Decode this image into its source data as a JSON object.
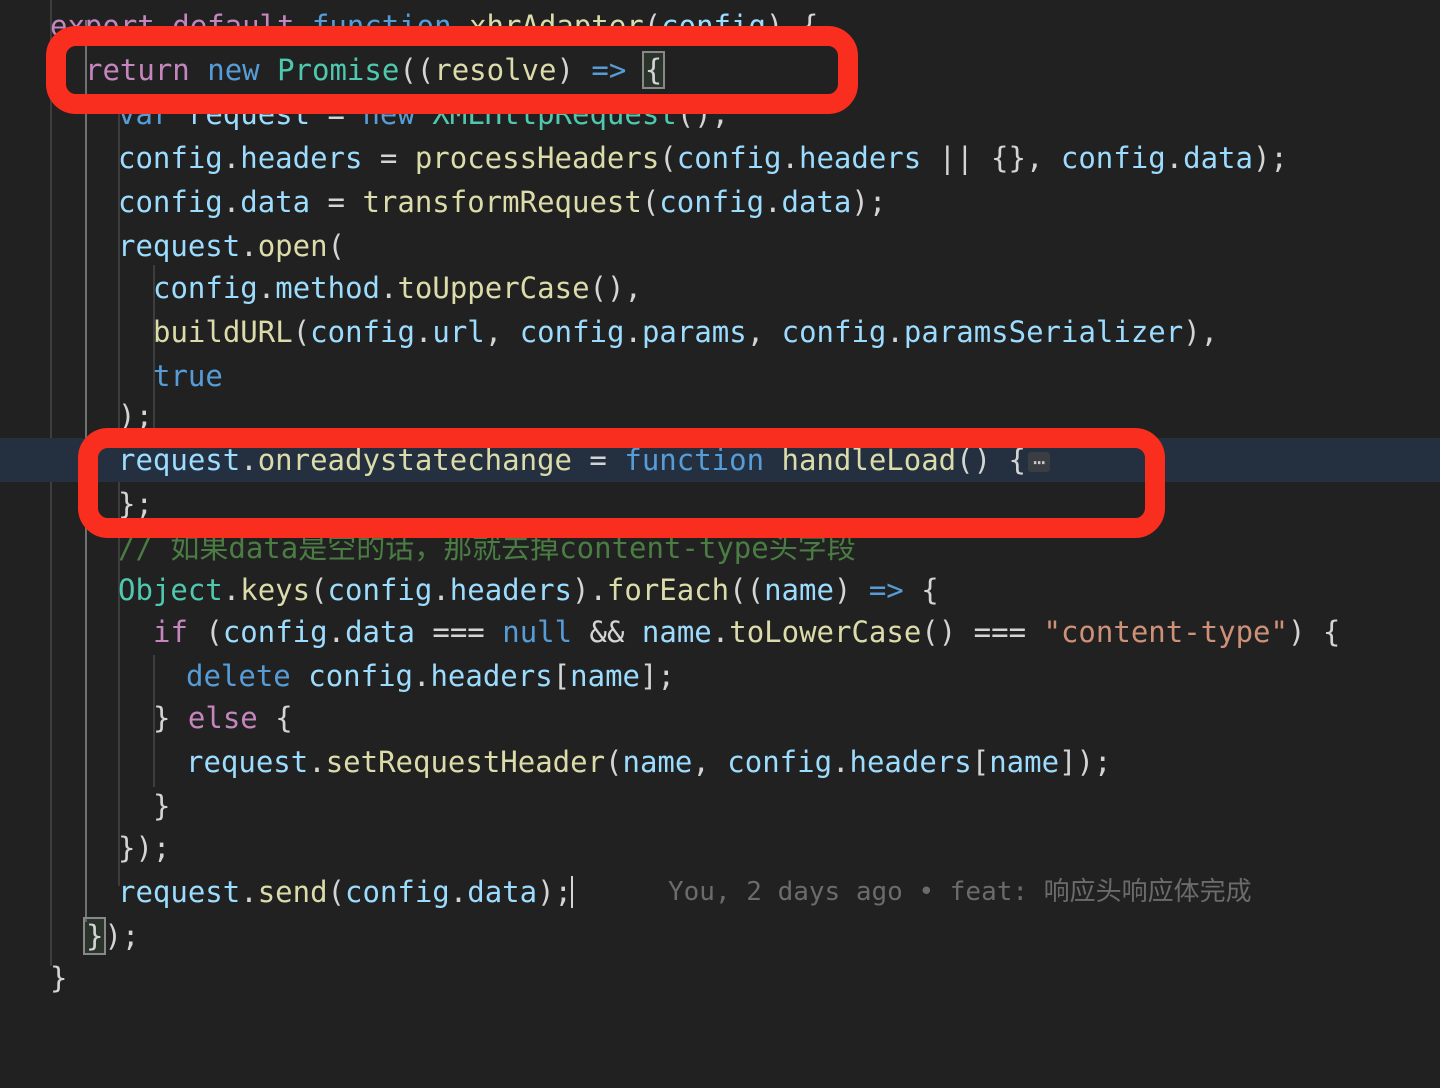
{
  "editor": {
    "theme_background": "#212121",
    "active_line_background": "#243040",
    "annotation_color": "#f92e1e",
    "gutter": {
      "fold_icon": "chevron-right-icon",
      "fold_icon_line": 12
    },
    "lines": [
      {
        "n": 1,
        "indent": 0,
        "text": "export default function xhrAdapter(config) {",
        "tokens": [
          {
            "t": "export",
            "c": "k"
          },
          {
            "t": " ",
            "c": "pl"
          },
          {
            "t": "default",
            "c": "k"
          },
          {
            "t": " ",
            "c": "pl"
          },
          {
            "t": "function",
            "c": "kb"
          },
          {
            "t": " ",
            "c": "pl"
          },
          {
            "t": "xhrAdapter",
            "c": "fn"
          },
          {
            "t": "(",
            "c": "op"
          },
          {
            "t": "config",
            "c": "var"
          },
          {
            "t": ") {",
            "c": "op"
          }
        ]
      },
      {
        "n": 2,
        "indent": 1,
        "text": "return new Promise((resolve) => {",
        "tokens": [
          {
            "t": "return",
            "c": "k"
          },
          {
            "t": " ",
            "c": "pl"
          },
          {
            "t": "new",
            "c": "kb"
          },
          {
            "t": " ",
            "c": "pl"
          },
          {
            "t": "Promise",
            "c": "cls"
          },
          {
            "t": "((",
            "c": "op"
          },
          {
            "t": "resolve",
            "c": "fn"
          },
          {
            "t": ") ",
            "c": "op"
          },
          {
            "t": "=>",
            "c": "arw"
          },
          {
            "t": " ",
            "c": "pl"
          },
          {
            "t": "{",
            "c": "bracket-match"
          }
        ]
      },
      {
        "n": 3,
        "indent": 2,
        "text": "var request = new XMLHttpRequest();",
        "tokens": [
          {
            "t": "var",
            "c": "kb"
          },
          {
            "t": " ",
            "c": "pl"
          },
          {
            "t": "request",
            "c": "var"
          },
          {
            "t": " = ",
            "c": "op"
          },
          {
            "t": "new",
            "c": "kb"
          },
          {
            "t": " ",
            "c": "pl"
          },
          {
            "t": "XMLHttpRequest",
            "c": "cls"
          },
          {
            "t": "();",
            "c": "op"
          }
        ]
      },
      {
        "n": 4,
        "indent": 2,
        "text": "config.headers = processHeaders(config.headers || {}, config.data);",
        "tokens": [
          {
            "t": "config",
            "c": "var"
          },
          {
            "t": ".",
            "c": "op"
          },
          {
            "t": "headers",
            "c": "var"
          },
          {
            "t": " = ",
            "c": "op"
          },
          {
            "t": "processHeaders",
            "c": "fn"
          },
          {
            "t": "(",
            "c": "op"
          },
          {
            "t": "config",
            "c": "var"
          },
          {
            "t": ".",
            "c": "op"
          },
          {
            "t": "headers",
            "c": "var"
          },
          {
            "t": " || {}, ",
            "c": "op"
          },
          {
            "t": "config",
            "c": "var"
          },
          {
            "t": ".",
            "c": "op"
          },
          {
            "t": "data",
            "c": "var"
          },
          {
            "t": ");",
            "c": "op"
          }
        ]
      },
      {
        "n": 5,
        "indent": 2,
        "text": "config.data = transformRequest(config.data);",
        "tokens": [
          {
            "t": "config",
            "c": "var"
          },
          {
            "t": ".",
            "c": "op"
          },
          {
            "t": "data",
            "c": "var"
          },
          {
            "t": " = ",
            "c": "op"
          },
          {
            "t": "transformRequest",
            "c": "fn"
          },
          {
            "t": "(",
            "c": "op"
          },
          {
            "t": "config",
            "c": "var"
          },
          {
            "t": ".",
            "c": "op"
          },
          {
            "t": "data",
            "c": "var"
          },
          {
            "t": ");",
            "c": "op"
          }
        ]
      },
      {
        "n": 6,
        "indent": 2,
        "text": "request.open(",
        "tokens": [
          {
            "t": "request",
            "c": "var"
          },
          {
            "t": ".",
            "c": "op"
          },
          {
            "t": "open",
            "c": "fn"
          },
          {
            "t": "(",
            "c": "op"
          }
        ]
      },
      {
        "n": 7,
        "indent": 3,
        "text": "config.method.toUpperCase(),",
        "tokens": [
          {
            "t": "config",
            "c": "var"
          },
          {
            "t": ".",
            "c": "op"
          },
          {
            "t": "method",
            "c": "var"
          },
          {
            "t": ".",
            "c": "op"
          },
          {
            "t": "toUpperCase",
            "c": "fn"
          },
          {
            "t": "(),",
            "c": "op"
          }
        ]
      },
      {
        "n": 8,
        "indent": 3,
        "text": "buildURL(config.url, config.params, config.paramsSerializer),",
        "tokens": [
          {
            "t": "buildURL",
            "c": "fn"
          },
          {
            "t": "(",
            "c": "op"
          },
          {
            "t": "config",
            "c": "var"
          },
          {
            "t": ".",
            "c": "op"
          },
          {
            "t": "url",
            "c": "var"
          },
          {
            "t": ", ",
            "c": "op"
          },
          {
            "t": "config",
            "c": "var"
          },
          {
            "t": ".",
            "c": "op"
          },
          {
            "t": "params",
            "c": "var"
          },
          {
            "t": ", ",
            "c": "op"
          },
          {
            "t": "config",
            "c": "var"
          },
          {
            "t": ".",
            "c": "op"
          },
          {
            "t": "paramsSerializer",
            "c": "var"
          },
          {
            "t": "),",
            "c": "op"
          }
        ]
      },
      {
        "n": 9,
        "indent": 3,
        "text": "true",
        "tokens": [
          {
            "t": "true",
            "c": "kb"
          }
        ]
      },
      {
        "n": 10,
        "indent": 2,
        "text": ");",
        "tokens": [
          {
            "t": ");",
            "c": "op"
          }
        ]
      },
      {
        "n": 11,
        "indent": 2,
        "text": "request.onreadystatechange = function handleLoad() {",
        "active": true,
        "folded": true,
        "fold_glyph": "⋯",
        "tokens": [
          {
            "t": "request",
            "c": "var"
          },
          {
            "t": ".",
            "c": "op"
          },
          {
            "t": "onreadystatechange",
            "c": "fn"
          },
          {
            "t": " = ",
            "c": "op"
          },
          {
            "t": "function",
            "c": "kb"
          },
          {
            "t": " ",
            "c": "pl"
          },
          {
            "t": "handleLoad",
            "c": "fn"
          },
          {
            "t": "() {",
            "c": "op"
          }
        ]
      },
      {
        "n": 12,
        "indent": 2,
        "text": "};",
        "tokens": [
          {
            "t": "};",
            "c": "op"
          }
        ]
      },
      {
        "n": 13,
        "indent": 2,
        "text": "// 如果data是空的话，那就去掉content-type头字段",
        "tokens": [
          {
            "t": "// 如果data是空的话，那就去掉content-type头字段",
            "c": "cm"
          }
        ]
      },
      {
        "n": 14,
        "indent": 2,
        "text": "Object.keys(config.headers).forEach((name) => {",
        "tokens": [
          {
            "t": "Object",
            "c": "cls"
          },
          {
            "t": ".",
            "c": "op"
          },
          {
            "t": "keys",
            "c": "fn"
          },
          {
            "t": "(",
            "c": "op"
          },
          {
            "t": "config",
            "c": "var"
          },
          {
            "t": ".",
            "c": "op"
          },
          {
            "t": "headers",
            "c": "var"
          },
          {
            "t": ").",
            "c": "op"
          },
          {
            "t": "forEach",
            "c": "fn"
          },
          {
            "t": "((",
            "c": "op"
          },
          {
            "t": "name",
            "c": "var"
          },
          {
            "t": ") ",
            "c": "op"
          },
          {
            "t": "=>",
            "c": "arw"
          },
          {
            "t": " {",
            "c": "op"
          }
        ]
      },
      {
        "n": 15,
        "indent": 3,
        "text": "if (config.data === null && name.toLowerCase() === \"content-type\") {",
        "tokens": [
          {
            "t": "if",
            "c": "k"
          },
          {
            "t": " (",
            "c": "op"
          },
          {
            "t": "config",
            "c": "var"
          },
          {
            "t": ".",
            "c": "op"
          },
          {
            "t": "data",
            "c": "var"
          },
          {
            "t": " === ",
            "c": "op"
          },
          {
            "t": "null",
            "c": "kb"
          },
          {
            "t": " && ",
            "c": "op"
          },
          {
            "t": "name",
            "c": "var"
          },
          {
            "t": ".",
            "c": "op"
          },
          {
            "t": "toLowerCase",
            "c": "fn"
          },
          {
            "t": "() === ",
            "c": "op"
          },
          {
            "t": "\"content-type\"",
            "c": "par"
          },
          {
            "t": ") {",
            "c": "op"
          }
        ]
      },
      {
        "n": 16,
        "indent": 4,
        "text": "delete config.headers[name];",
        "tokens": [
          {
            "t": "delete",
            "c": "kb"
          },
          {
            "t": " ",
            "c": "pl"
          },
          {
            "t": "config",
            "c": "var"
          },
          {
            "t": ".",
            "c": "op"
          },
          {
            "t": "headers",
            "c": "var"
          },
          {
            "t": "[",
            "c": "op"
          },
          {
            "t": "name",
            "c": "var"
          },
          {
            "t": "];",
            "c": "op"
          }
        ]
      },
      {
        "n": 17,
        "indent": 3,
        "text": "} else {",
        "tokens": [
          {
            "t": "} ",
            "c": "op"
          },
          {
            "t": "else",
            "c": "k"
          },
          {
            "t": " {",
            "c": "op"
          }
        ]
      },
      {
        "n": 18,
        "indent": 4,
        "text": "request.setRequestHeader(name, config.headers[name]);",
        "tokens": [
          {
            "t": "request",
            "c": "var"
          },
          {
            "t": ".",
            "c": "op"
          },
          {
            "t": "setRequestHeader",
            "c": "fn"
          },
          {
            "t": "(",
            "c": "op"
          },
          {
            "t": "name",
            "c": "var"
          },
          {
            "t": ", ",
            "c": "op"
          },
          {
            "t": "config",
            "c": "var"
          },
          {
            "t": ".",
            "c": "op"
          },
          {
            "t": "headers",
            "c": "var"
          },
          {
            "t": "[",
            "c": "op"
          },
          {
            "t": "name",
            "c": "var"
          },
          {
            "t": "]);",
            "c": "op"
          }
        ]
      },
      {
        "n": 19,
        "indent": 3,
        "text": "}",
        "tokens": [
          {
            "t": "}",
            "c": "op"
          }
        ]
      },
      {
        "n": 20,
        "indent": 2,
        "text": "});",
        "tokens": [
          {
            "t": "});",
            "c": "op"
          }
        ]
      },
      {
        "n": 21,
        "indent": 2,
        "text": "request.send(config.data);",
        "has_caret": true,
        "tokens": [
          {
            "t": "request",
            "c": "var"
          },
          {
            "t": ".",
            "c": "op"
          },
          {
            "t": "send",
            "c": "fn"
          },
          {
            "t": "(",
            "c": "op"
          },
          {
            "t": "config",
            "c": "var"
          },
          {
            "t": ".",
            "c": "op"
          },
          {
            "t": "data",
            "c": "var"
          },
          {
            "t": ");",
            "c": "op"
          }
        ]
      },
      {
        "n": 22,
        "indent": 1,
        "text": "});",
        "tokens": [
          {
            "t": "}",
            "c": "bracket-match"
          },
          {
            "t": ");",
            "c": "op"
          }
        ]
      },
      {
        "n": 23,
        "indent": 0,
        "text": "}",
        "tokens": [
          {
            "t": "}",
            "c": "op"
          }
        ]
      }
    ],
    "blame": {
      "author": "You",
      "when": "2 days ago",
      "separator": "•",
      "message": "feat: 响应头响应体完成",
      "full": "You, 2 days ago • feat: 响应头响应体完成"
    },
    "annotations": [
      {
        "id": "annotation-box-return-promise",
        "label": "return new Promise((resolve) => {"
      },
      {
        "id": "annotation-box-onreadystatechange",
        "label": "request.onreadystatechange = function handleLoad() {⋯};"
      }
    ]
  }
}
